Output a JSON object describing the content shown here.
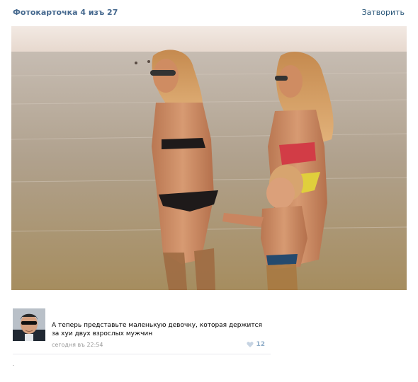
{
  "header": {
    "title": "Фотокарточка 4 изъ 27",
    "close_label": "Затворить"
  },
  "comment": {
    "text": "А теперь представьте маленькую девочку, которая держится за хуи двух взрослых мужчин",
    "timestamp": "сегодня въ 22:54",
    "likes": "12"
  },
  "icons": {
    "like": "heart-icon"
  },
  "colors": {
    "link": "#2b587a",
    "title": "#45688e",
    "meta": "#999999",
    "like": "#8fadc8"
  }
}
